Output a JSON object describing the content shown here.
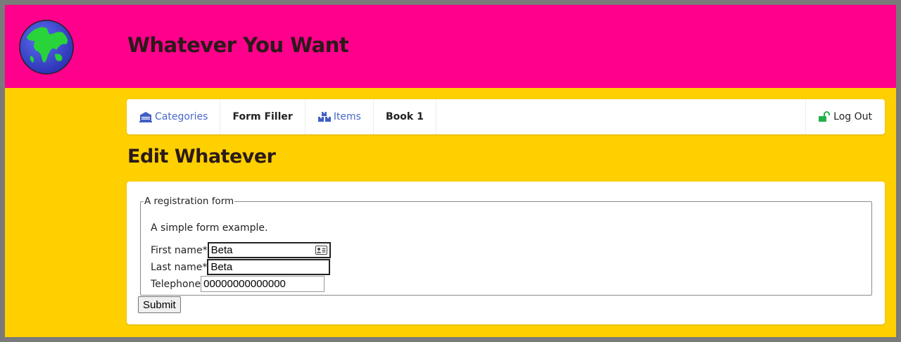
{
  "header": {
    "site_title": "Whatever You Want",
    "logo_icon": "globe-icon"
  },
  "nav": {
    "items": [
      {
        "label": "Categories",
        "icon": "building-icon",
        "style": "link"
      },
      {
        "label": "Form Filler",
        "style": "bold"
      },
      {
        "label": "Items",
        "icon": "boxes-icon",
        "style": "link"
      },
      {
        "label": "Book 1",
        "style": "bold"
      }
    ],
    "logout": {
      "label": "Log Out",
      "icon": "unlock-icon"
    }
  },
  "page": {
    "title": "Edit Whatever"
  },
  "form": {
    "legend": "A registration form",
    "description": "A simple form example.",
    "fields": [
      {
        "label": "First name*",
        "value": "Beta"
      },
      {
        "label": "Last name*",
        "value": "Beta"
      },
      {
        "label": "Telephone",
        "value": "00000000000000"
      }
    ],
    "submit_label": "Submit"
  },
  "colors": {
    "header_bg": "#ff008c",
    "page_bg": "#ffd000",
    "link": "#4a67c7",
    "unlock_icon": "#22b14c"
  }
}
